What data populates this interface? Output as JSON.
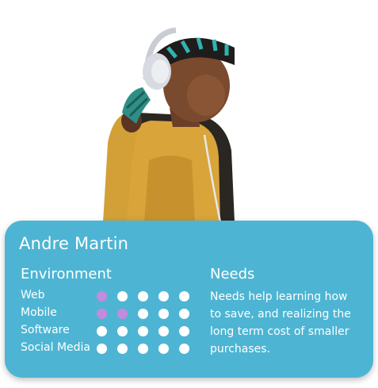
{
  "persona": {
    "name": "Andre Martin",
    "photo_alt": "",
    "colors": {
      "card_background": "#4db5d3",
      "text": "#ffffff",
      "dot_filled": "#c38bdc",
      "dot_empty": "#ffffff"
    }
  },
  "environment": {
    "heading": "Environment",
    "max_level": 5,
    "items": [
      {
        "label": "Web",
        "level": 1
      },
      {
        "label": "Mobile",
        "level": 2
      },
      {
        "label": "Software",
        "level": 0
      },
      {
        "label": "Social Media",
        "level": 0
      }
    ]
  },
  "needs": {
    "heading": "Needs",
    "text": "Needs help learning how to save, and realizing the long term cost of smaller purchases."
  }
}
